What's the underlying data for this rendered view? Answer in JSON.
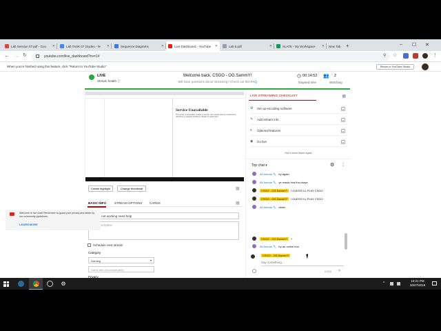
{
  "browser": {
    "tabs": [
      {
        "title": "Lab Session 07.pdf - Goo",
        "color": "#db4437"
      },
      {
        "title": "Lab TASK 07 (Sydeo - M",
        "color": "#4285f4"
      },
      {
        "title": "Sequence Diagrams",
        "color": "#3b78e7"
      },
      {
        "title": "Live Dashboard - YouTube",
        "color": "#e62117"
      },
      {
        "title": "Lab 5.pdf",
        "color": "#9aa0a6"
      },
      {
        "title": "SLATE - My Workspace",
        "color": "#0f9d58"
      },
      {
        "title": "New Tab",
        "color": "#dee1e6"
      }
    ],
    "url": "youtube.com/live_dashboard?nv=1#"
  },
  "banner": {
    "text": "When you're finished using this feature, click \"Return to YouTube Studio\"",
    "button": "Return to YouTube Studio"
  },
  "dashboard": {
    "live_label": "LIVE",
    "health_label": "Stream health",
    "welcome": "Welcome back, CSGO - OG.SammY!",
    "subwelcome": "Still have questions about streaming? Check out this",
    "faq": "FAQ",
    "elapsed_value": "00:14:52",
    "elapsed_label": "Elapsed time",
    "watching_value": "2",
    "watching_label": "Watching"
  },
  "preview": {
    "service_title": "Service Unavailable",
    "service_text": "The server is temporarily unable to service your request due to maintenance downtime or capacity problems. Please try again later."
  },
  "actions": {
    "highlight": "Create highlight",
    "thumbnail": "Change thumbnail"
  },
  "form_tabs": [
    "BASIC INFO",
    "STREAM OPTIONS",
    "CARDS"
  ],
  "form": {
    "title_value": "eclipse not working need help",
    "description_placeholder": "Add description",
    "schedule_label": "Schedule next stream",
    "category_label": "Category",
    "category_value": "Gaming",
    "game_placeholder": "Game title (recommended)",
    "privacy_label": "Privacy"
  },
  "checklist": {
    "title": "LIVE STREAMING CHECKLIST",
    "items": [
      {
        "label": "Set up encoding software",
        "icon": "settings-icon"
      },
      {
        "label": "Add stream info",
        "icon": "edit-icon"
      },
      {
        "label": "Optional features",
        "icon": "list-icon"
      },
      {
        "label": "Go live",
        "icon": "broadcast-icon"
      }
    ],
    "hide": "Don't show these again"
  },
  "chat": {
    "mode": "Top chat",
    "messages": [
      {
        "author": "Ali Ammar 🔧",
        "text": "try again",
        "owner": false,
        "avatar": "#8e6cc2"
      },
      {
        "author": "Ali Ammar 🔧",
        "text": "ye masla hna tha chaye",
        "owner": false,
        "avatar": "#8e6cc2"
      },
      {
        "author": "CSGO - OG.SammY!",
        "text": "I GUESS ILL PLAY CSGO",
        "owner": true,
        "avatar": "#3a2c1e"
      },
      {
        "author": "CSGO - OG.SammY!",
        "text": "I GUESS ILL PLAY CSGO",
        "owner": true,
        "avatar": "#3a2c1e"
      },
      {
        "author": "Ali Ammar 🔧",
        "text": "damn",
        "owner": false,
        "avatar": "#8e6cc2"
      },
      {
        "author": "CSGO - OG.SammY!",
        "text": "?",
        "owner": true,
        "avatar": "#3a2c1e"
      },
      {
        "author": "Ali Ammar 🔧",
        "text": "try an online tool",
        "owner": false,
        "avatar": "#8e6cc2"
      }
    ],
    "notice": "Welcome to live chat! Remember to guard your privacy and abide by our community guidelines.",
    "notice_link": "LEARN MORE",
    "input_author": "CSGO - OG.SammY!",
    "input_placeholder": "Say something...",
    "char_count": "0/200"
  },
  "taskbar": {
    "time": "10:21 PM",
    "date": "10/27/2019"
  }
}
